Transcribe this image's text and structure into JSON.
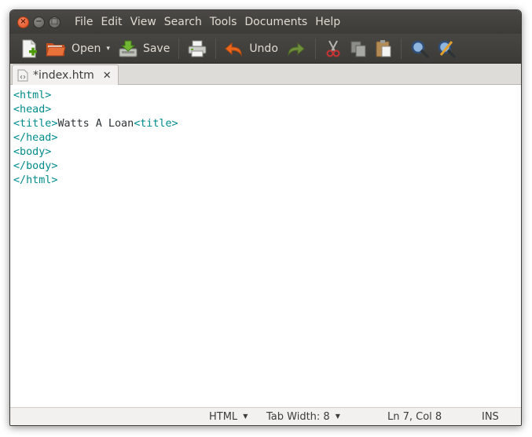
{
  "window": {
    "buttons": {
      "close": "×",
      "minimize": "−",
      "maximize": "□"
    }
  },
  "menu": {
    "items": [
      "File",
      "Edit",
      "View",
      "Search",
      "Tools",
      "Documents",
      "Help"
    ]
  },
  "toolbar": {
    "new_icon": "new-document-icon",
    "open_label": "Open",
    "open_arrow": "▾",
    "save_label": "Save",
    "print_icon": "print-icon",
    "undo_label": "Undo",
    "redo_icon": "redo-icon",
    "cut_icon": "scissors-icon",
    "copy_icon": "copy-icon",
    "paste_icon": "clipboard-icon",
    "find_icon": "magnifier-icon",
    "replace_icon": "find-replace-icon"
  },
  "tabs": [
    {
      "label": "*index.htm",
      "close": "✕"
    }
  ],
  "editor": {
    "lines": [
      [
        {
          "t": "tag",
          "v": "<html>"
        }
      ],
      [
        {
          "t": "tag",
          "v": "<head>"
        }
      ],
      [
        {
          "t": "tag",
          "v": "<title>"
        },
        {
          "t": "txt",
          "v": "Watts A Loan"
        },
        {
          "t": "tag",
          "v": "<title>"
        }
      ],
      [
        {
          "t": "tag",
          "v": "</head>"
        }
      ],
      [
        {
          "t": "tag",
          "v": "<body>"
        }
      ],
      [
        {
          "t": "tag",
          "v": "</body>"
        }
      ],
      [
        {
          "t": "tag",
          "v": "</html>"
        }
      ]
    ]
  },
  "status": {
    "language": "HTML",
    "tab_width": "Tab Width: 8",
    "dropdown_arrow": "▼",
    "position": "Ln 7, Col 8",
    "mode": "INS"
  },
  "colors": {
    "tag": "#008b8b",
    "text": "#2e3436",
    "titlebar": "#3c3b37",
    "close_button": "#df4b16"
  }
}
